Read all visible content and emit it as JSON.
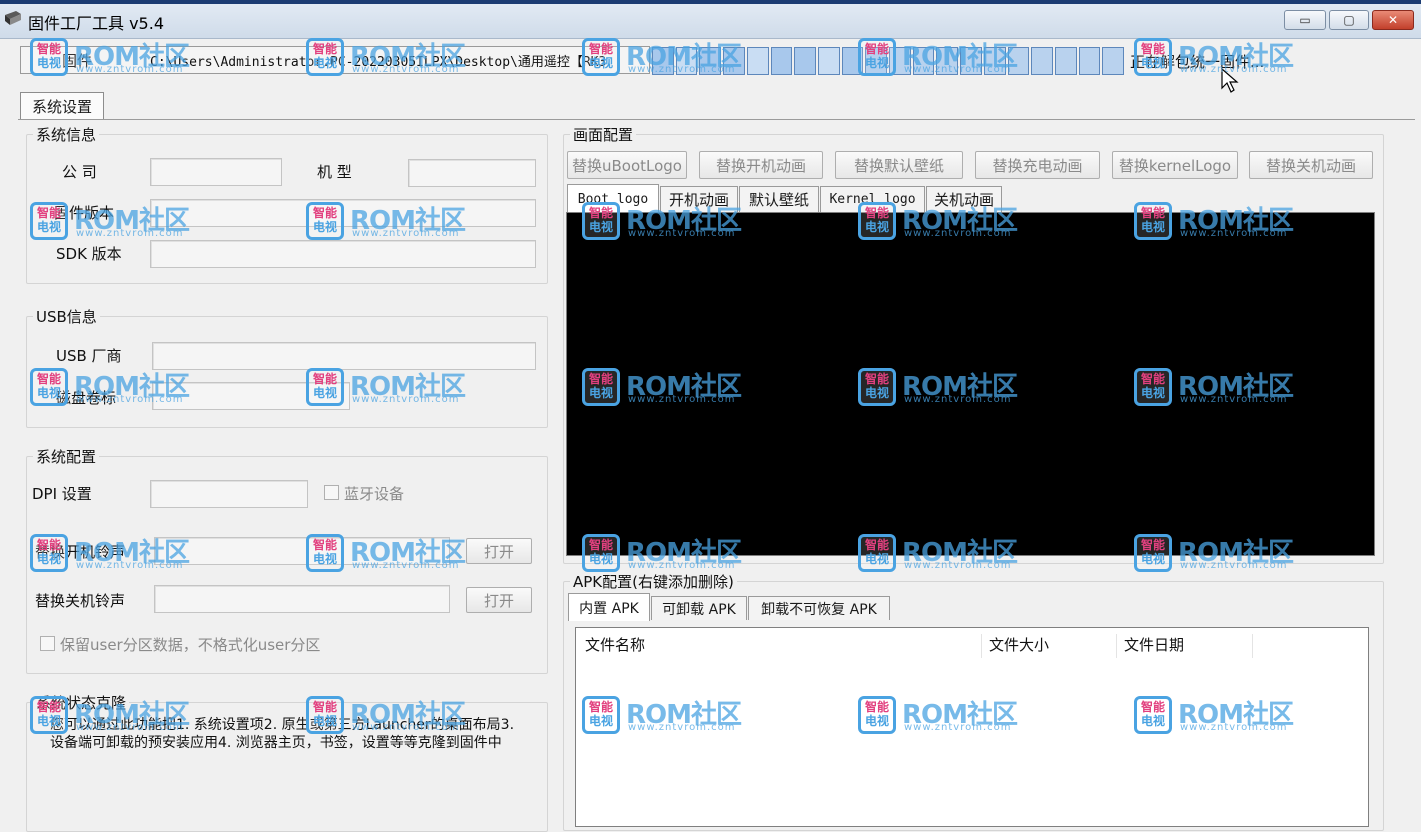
{
  "window": {
    "title": "固件工厂工具 v5.4",
    "min_glyph": "▭",
    "max_glyph": "▢",
    "close_glyph": "✕"
  },
  "firmware": {
    "label": "固件",
    "path": "C:\\Users\\Administrator.PC-20220305ILPX\\Desktop\\通用遥控【RK3",
    "progress_fraction": 0.5,
    "progress_segments": 20,
    "status": "正在解包统一固件..."
  },
  "tabs": {
    "system_settings": "系统设置"
  },
  "system_info": {
    "title": "系统信息",
    "company_label": "公  司",
    "model_label": "机  型",
    "firmware_version_label": "固件版本",
    "sdk_version_label": "SDK 版本",
    "company_value": "",
    "model_value": "",
    "firmware_version_value": "",
    "sdk_version_value": ""
  },
  "usb_info": {
    "title": "USB信息",
    "vendor_label": "USB 厂商",
    "volume_label": "磁盘卷标",
    "vendor_value": "",
    "volume_value": ""
  },
  "system_config": {
    "title": "系统配置",
    "dpi_label": "DPI 设置",
    "dpi_value": "",
    "bluetooth_label": "蓝牙设备",
    "boot_ringtone_label": "替换开机铃声",
    "shutdown_ringtone_label": "替换关机铃声",
    "open_button": "打开",
    "keep_user_label": "保留user分区数据，不格式化user分区"
  },
  "clone": {
    "title": "系统状态克隆",
    "description": "您可以通过此功能把1. 系统设置项2. 原生或第三方Launcher的桌面布局3. 设备端可卸载的预安装应用4. 浏览器主页，书签，设置等等克隆到固件中"
  },
  "image_config": {
    "title": "画面配置",
    "buttons": [
      "替换uBootLogo",
      "替换开机动画",
      "替换默认壁纸",
      "替换充电动画",
      "替换kernelLogo",
      "替换关机动画"
    ],
    "tabs": [
      "Boot logo",
      "开机动画",
      "默认壁纸",
      "Kernel logo",
      "关机动画"
    ]
  },
  "apk_config": {
    "title": "APK配置(右键添加删除)",
    "tabs": [
      "内置 APK",
      "可卸载 APK",
      "卸载不可恢复 APK"
    ],
    "columns": [
      "文件名称",
      "文件大小",
      "文件日期"
    ],
    "rows": []
  },
  "watermark": {
    "line1": "智能",
    "line2": "电视",
    "brand": "ROM社区",
    "site": "www.zntvrom.com"
  },
  "colors": {
    "background": "#f0f0f0",
    "progress_fill": "#a8c8ec",
    "preview": "#000000",
    "watermark": "#4aa3e2"
  }
}
